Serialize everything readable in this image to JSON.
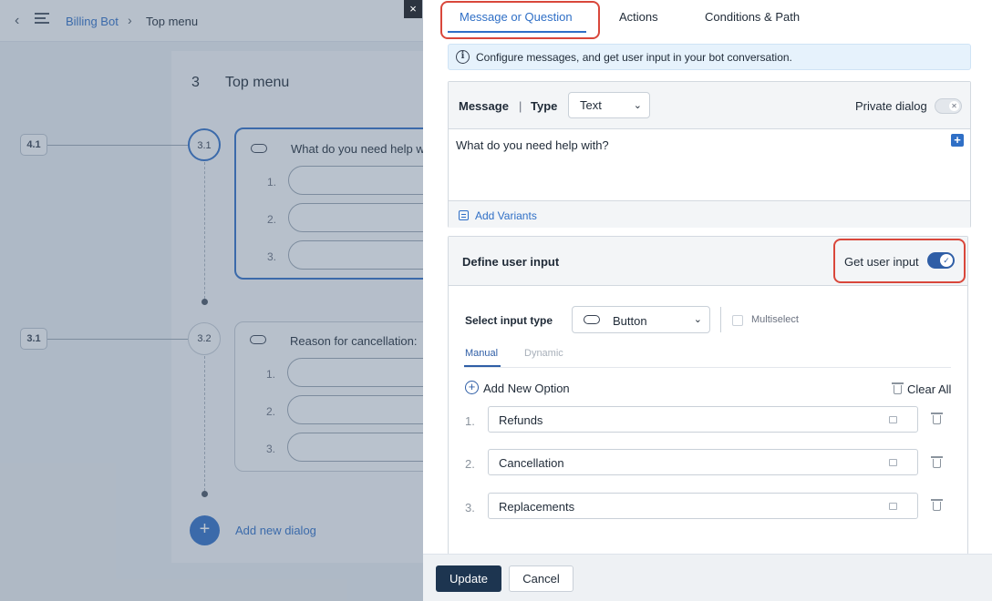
{
  "breadcrumb": {
    "back_icon": "chevron-left-icon",
    "menu_icon": "hamburger-menu-icon",
    "parent": "Billing Bot",
    "separator": "›",
    "current": "Top menu"
  },
  "canvas": {
    "title_number": "3",
    "title": "Top menu",
    "nodes": [
      {
        "badge": "4.1",
        "step": "3.1",
        "title": "What do you need help w",
        "options": [
          "1.",
          "2.",
          "3."
        ]
      },
      {
        "badge": "3.1",
        "step": "3.2",
        "title": "Reason for cancellation:",
        "options": [
          "1.",
          "2.",
          "3."
        ]
      }
    ],
    "add_dialog": "Add new dialog",
    "add_icon": "+"
  },
  "close_icon": "×",
  "tabs": [
    {
      "label": "Message or Question",
      "active": true
    },
    {
      "label": "Actions",
      "active": false
    },
    {
      "label": "Conditions & Path",
      "active": false
    }
  ],
  "info": {
    "icon": "i",
    "text": "Configure messages, and get user input in your bot conversation."
  },
  "message": {
    "label": "Message",
    "separator": "|",
    "type_label": "Type",
    "type_value": "Text",
    "private_label": "Private dialog",
    "private_enabled": false,
    "text": "What do you need help with?",
    "add_icon": "+",
    "add_variants": "Add Variants"
  },
  "user_input": {
    "title": "Define user input",
    "get_label": "Get user input",
    "get_enabled": true,
    "toggle_icon": "✓",
    "input_type_label": "Select input type",
    "input_type_value": "Button",
    "multiselect_label": "Multiselect",
    "multiselect_checked": false,
    "subtabs": [
      "Manual",
      "Dynamic"
    ],
    "add_option": "Add New Option",
    "add_option_icon": "+",
    "clear_all": "Clear All",
    "options": [
      {
        "num": "1.",
        "value": "Refunds"
      },
      {
        "num": "2.",
        "value": "Cancellation"
      },
      {
        "num": "3.",
        "value": "Replacements"
      }
    ]
  },
  "footer": {
    "update": "Update",
    "cancel": "Cancel"
  },
  "colors": {
    "accent": "#2f6fc6",
    "highlight": "#d9473b",
    "primary_button": "#1d3550"
  }
}
